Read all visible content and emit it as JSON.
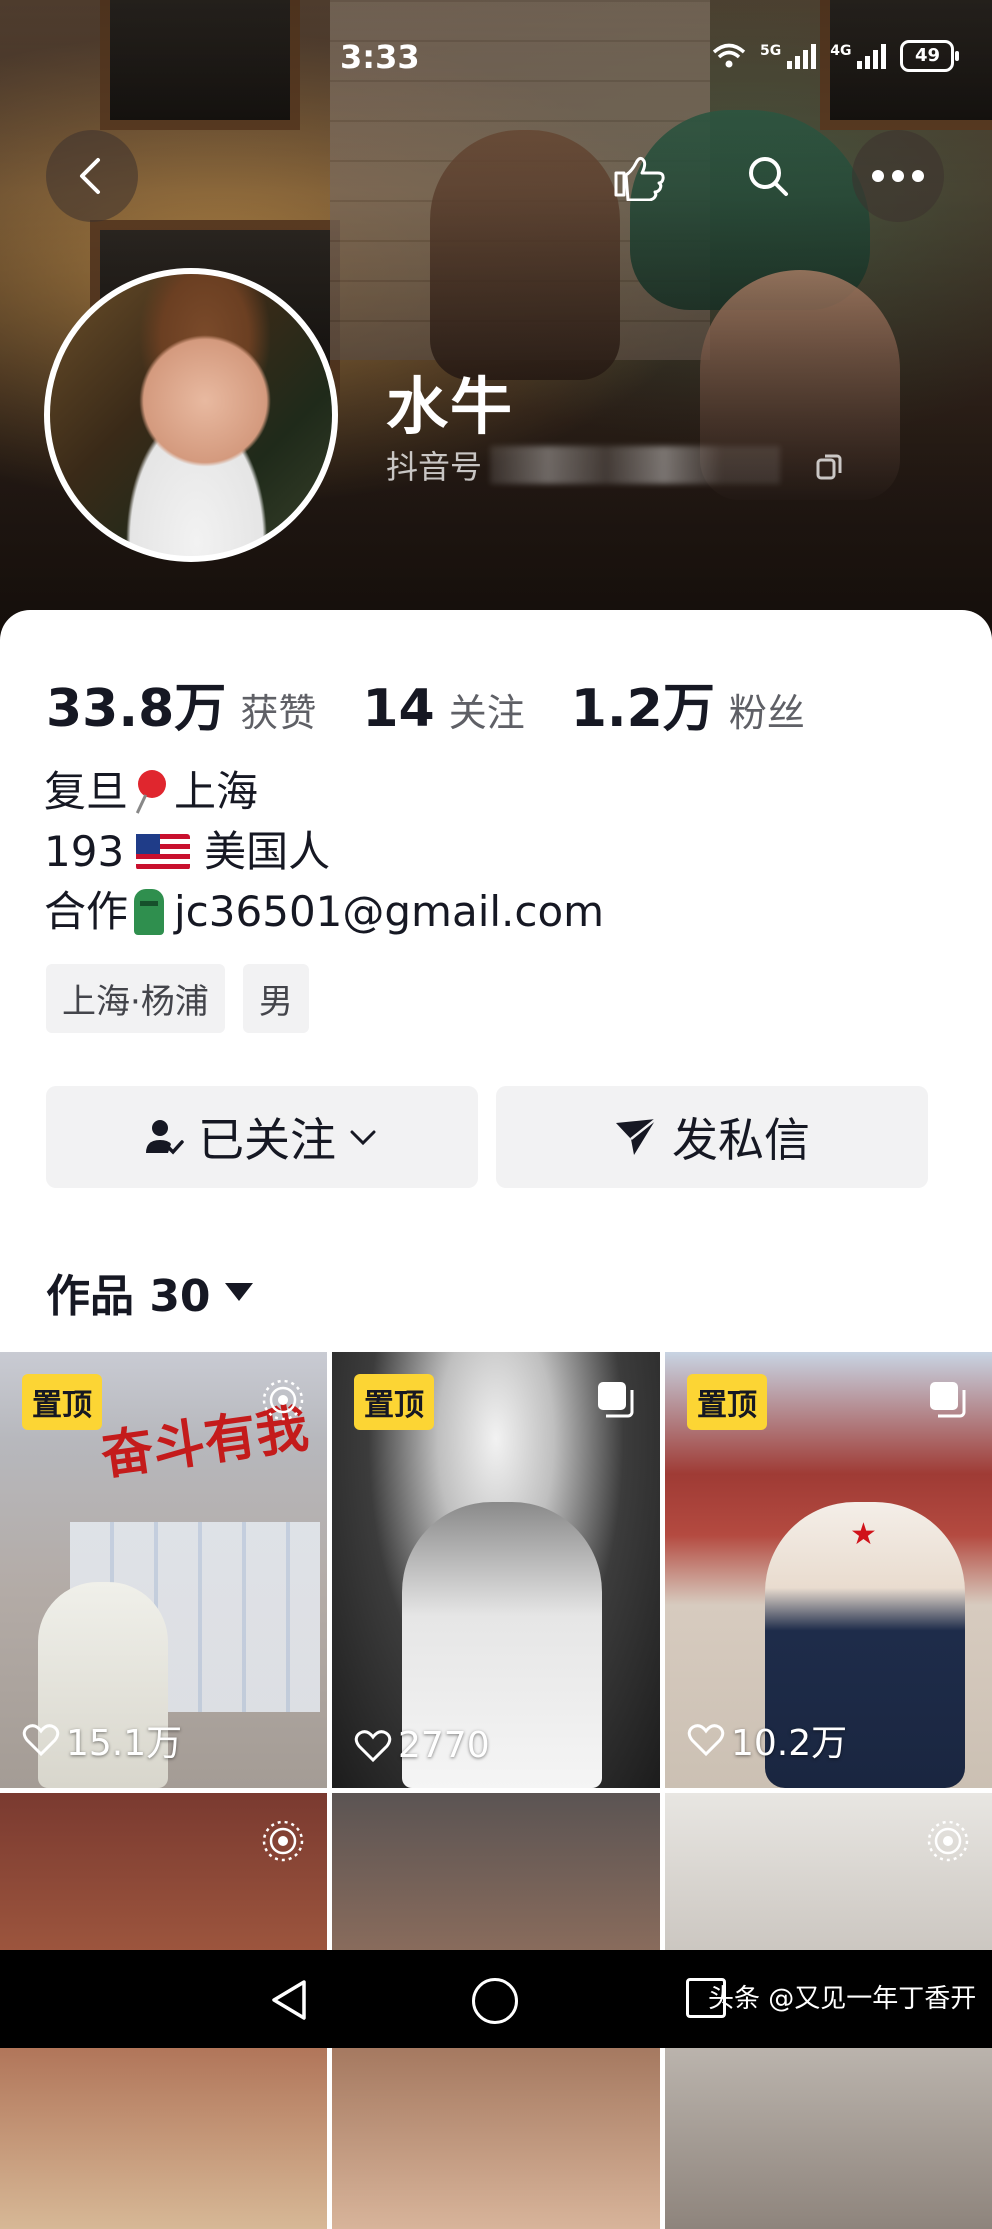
{
  "status_bar": {
    "time": "3:33",
    "battery": "49",
    "net1": "5G",
    "net2": "4G"
  },
  "profile": {
    "nickname": "水牛",
    "douyin_id_label": "抖音号",
    "stats": [
      {
        "value": "33.8万",
        "label": "获赞"
      },
      {
        "value": "14",
        "label": "关注"
      },
      {
        "value": "1.2万",
        "label": "粉丝"
      }
    ],
    "bio": {
      "line1_a": "复旦",
      "line1_b": "上海",
      "line2_a": "193",
      "line2_b": "美国人",
      "line3_a": "合作",
      "line3_b": "jc36501@gmail.com"
    },
    "tags": [
      "上海·杨浦",
      "男"
    ]
  },
  "actions": {
    "follow_label": "已关注",
    "message_label": "发私信"
  },
  "works": {
    "label": "作品 30",
    "tiles": [
      {
        "pinned": "置顶",
        "likes": "15.1万",
        "wall_text": "奋斗有我"
      },
      {
        "pinned": "置顶",
        "likes": "2770"
      },
      {
        "pinned": "置顶",
        "likes": "10.2万"
      },
      {},
      {},
      {}
    ]
  },
  "nav": {
    "watermark": "头条 @又见一年丁香开"
  },
  "icons": [
    "back-icon",
    "hand-icon",
    "search-icon",
    "more-icon",
    "copy-icon",
    "follow-person-icon",
    "chevron-down-icon",
    "send-icon",
    "caret-down-icon",
    "heart-icon",
    "live-icon",
    "multi-image-icon"
  ]
}
